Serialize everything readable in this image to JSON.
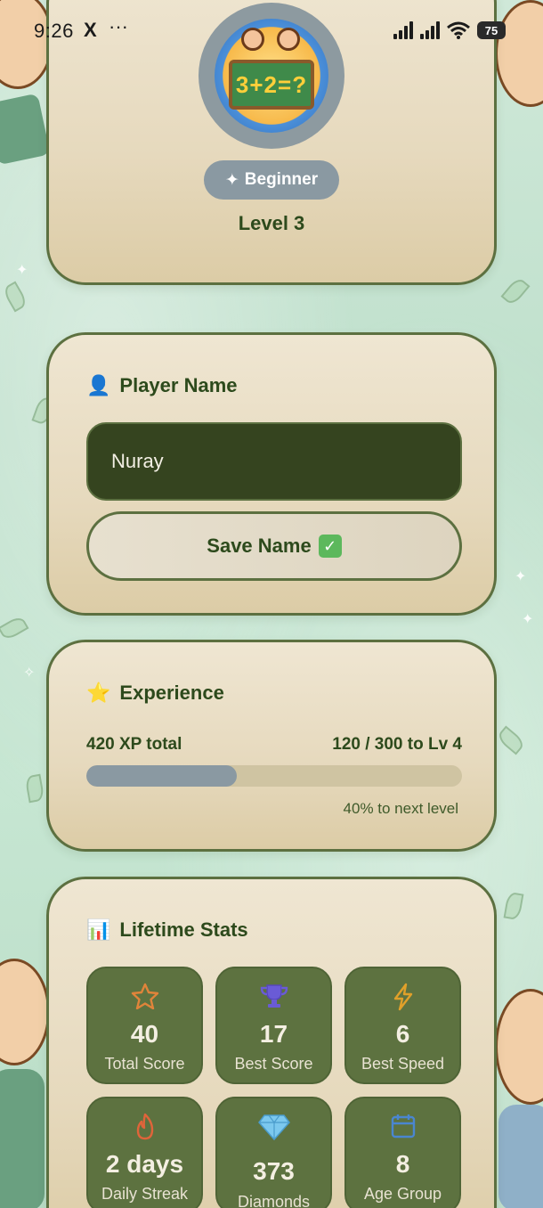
{
  "status_bar": {
    "time": "9:26",
    "x_icon": "X",
    "more": "···",
    "battery": "75"
  },
  "profile": {
    "avatar_alt": "math kids avatar",
    "avatar_equation": "3+2=?",
    "badge_icon": "✦",
    "badge_label": "Beginner",
    "level_label": "Level 3"
  },
  "player_name": {
    "icon": "👤",
    "title": "Player Name",
    "input_value": "Nuray",
    "save_label": "Save Name",
    "save_emoji": "✓"
  },
  "experience": {
    "icon": "⭐",
    "title": "Experience",
    "total": "420 XP total",
    "progress_text": "120 / 300 to Lv 4",
    "progress_fraction": 0.4,
    "next_level": "40% to next level"
  },
  "lifetime_stats": {
    "icon": "📊",
    "title": "Lifetime Stats",
    "tiles": [
      {
        "icon": "star-icon",
        "value": "40",
        "label": "Total Score",
        "color": "#e0843a"
      },
      {
        "icon": "trophy-icon",
        "value": "17",
        "label": "Best Score",
        "color": "#6a5bd6"
      },
      {
        "icon": "lightning-icon",
        "value": "6",
        "label": "Best Speed",
        "color": "#e0a02a"
      },
      {
        "icon": "flame-icon",
        "value": "2 days",
        "label": "Daily Streak",
        "color": "#e0643a"
      },
      {
        "icon": "diamond-icon",
        "value": "373",
        "label": "Diamonds",
        "color": "#5ab0e0"
      },
      {
        "icon": "calendar-icon",
        "value": "8",
        "label": "Age Group",
        "color": "#4a86d0"
      }
    ]
  },
  "colors": {
    "accent_green": "#2d4a1c",
    "tile_green": "#5d7240",
    "card_border": "#5c7040",
    "progress_fill": "#8a99a2"
  }
}
